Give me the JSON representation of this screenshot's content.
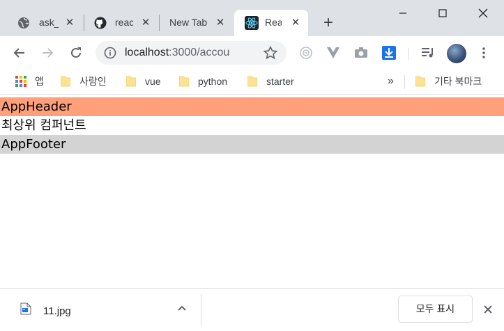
{
  "tabs": [
    {
      "title": "ask_",
      "favicon": "globe-icon",
      "active": false
    },
    {
      "title": "reac",
      "favicon": "github-icon",
      "active": false
    },
    {
      "title": "New Tab",
      "favicon": "",
      "active": false
    },
    {
      "title": "Rea",
      "favicon": "react-icon",
      "active": true
    }
  ],
  "toolbar": {
    "url_host": "localhost",
    "url_rest": ":3000/accou"
  },
  "bookmarks": {
    "apps_label": "앱",
    "items": [
      "사람인",
      "vue",
      "python",
      "starter"
    ],
    "overflow": "»",
    "other": "기타 북마크"
  },
  "page": {
    "header_text": "AppHeader",
    "body_text": "최상위 컴퍼넌트",
    "footer_text": "AppFooter",
    "colors": {
      "header_bg": "#ffa07a",
      "footer_bg": "#d3d3d3"
    }
  },
  "downloads": {
    "file_name": "11.jpg",
    "show_all": "모두 표시"
  }
}
